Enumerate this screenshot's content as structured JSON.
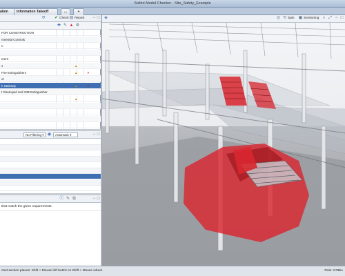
{
  "window": {
    "title": "Solibri Model Checker - Site_Safety_Example"
  },
  "tabs": [
    {
      "label": "ation"
    },
    {
      "label": "Information Takeoff"
    },
    {
      "label": "..."
    },
    {
      "label": "+"
    }
  ],
  "ruleset_toolbar": {
    "check_label": "Check",
    "report_label": "Report"
  },
  "ruleset": {
    "rows": [
      {
        "label": "FOR CONSTRUCTION",
        "badge": ""
      },
      {
        "label": "nmental Controls",
        "badge": ""
      },
      {
        "label": "n",
        "badge": ""
      },
      {
        "label": "",
        "badge": ""
      },
      {
        "label": "ment",
        "badge": ""
      },
      {
        "label": "s",
        "badge": "warn"
      },
      {
        "label": "Fire Extinguishers",
        "badge": "warn-x"
      },
      {
        "label": "or",
        "badge": ""
      },
      {
        "label": "h Stairway",
        "badge": "warn-x"
      },
      {
        "label": "t GasLiquid and 10B Extinguisher",
        "badge": ""
      },
      {
        "label": "",
        "badge": "warn"
      },
      {
        "label": "",
        "badge": ""
      },
      {
        "label": "",
        "badge": ""
      },
      {
        "label": "",
        "badge": ""
      },
      {
        "label": "",
        "badge": ""
      }
    ]
  },
  "results_toolbar": {
    "filter_label": "No Filtering",
    "mode_label": "Automatic"
  },
  "info": {
    "text": "that match the given requirements."
  },
  "view_toolbar": {
    "spin_label": "Spin",
    "sectioning_label": "Sectioning"
  },
  "statusbar": {
    "hint": "cted section planes: Shift + Mouse left button or Shift + Mouse wheel.",
    "role": "Role: COBie"
  },
  "colors": {
    "accent": "#3f6fb3",
    "highlight": "#d9262f",
    "warning": "#e0a100",
    "error": "#c21a1a"
  }
}
